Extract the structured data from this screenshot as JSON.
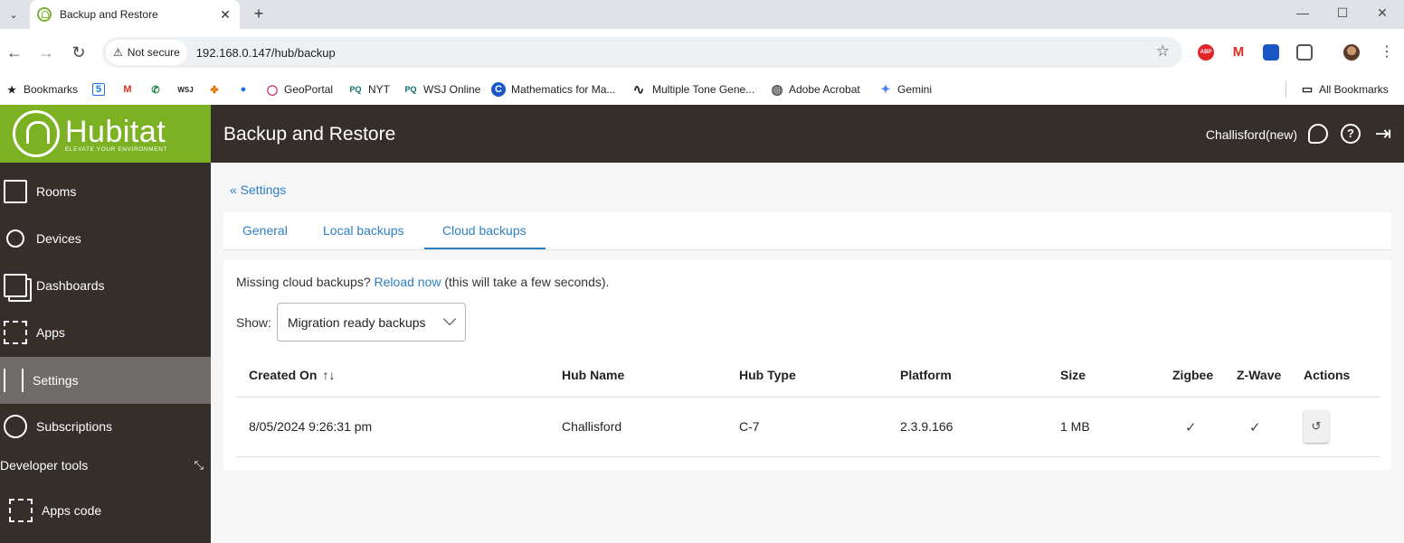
{
  "browser": {
    "tab_title": "Backup and Restore",
    "tab_close": "✕",
    "new_tab": "+",
    "tab_menu": "⌄",
    "window_controls": {
      "minimize": "—",
      "maximize": "☐",
      "close": "✕"
    },
    "nav": {
      "back": "←",
      "forward": "→",
      "reload": "↻"
    },
    "security_label": "Not secure",
    "url": "192.168.0.147/hub/backup",
    "star": "☆",
    "extensions": {
      "abp": "ABP",
      "gmail": "M",
      "more": "⋮"
    },
    "bookmarks": [
      {
        "label": "Bookmarks",
        "icon": "star-icon",
        "glyph": "★"
      },
      {
        "label": "",
        "icon": "calendar-icon",
        "glyph": "5"
      },
      {
        "label": "",
        "icon": "gmail-icon",
        "glyph": "M"
      },
      {
        "label": "",
        "icon": "phone-icon",
        "glyph": "✆"
      },
      {
        "label": "",
        "icon": "wsj-icon",
        "glyph": "WSJ"
      },
      {
        "label": "",
        "icon": "photos-icon",
        "glyph": "✤"
      },
      {
        "label": "",
        "icon": "contacts-icon",
        "glyph": "●"
      },
      {
        "label": "GeoPortal",
        "icon": "geoportal-icon",
        "glyph": "◯"
      },
      {
        "label": "NYT",
        "icon": "pq-icon",
        "glyph": "PQ"
      },
      {
        "label": "WSJ Online",
        "icon": "pq-icon",
        "glyph": "PQ"
      },
      {
        "label": "Mathematics for Ma...",
        "icon": "c-icon",
        "glyph": "C"
      },
      {
        "label": "Multiple Tone Gene...",
        "icon": "wave-icon",
        "glyph": "∿"
      },
      {
        "label": "Adobe Acrobat",
        "icon": "globe-icon",
        "glyph": "◍"
      },
      {
        "label": "Gemini",
        "icon": "gemini-icon",
        "glyph": "✦"
      }
    ],
    "all_bookmarks": "All Bookmarks",
    "all_bookmarks_glyph": "▭"
  },
  "app": {
    "brand_name": "Hubitat",
    "brand_tagline": "ELEVATE YOUR ENVIRONMENT",
    "page_title": "Backup and Restore",
    "hub_name": "Challisford(new)",
    "help_glyph": "?",
    "logout_glyph": "⇥",
    "colors": {
      "brand_green": "#7bb122",
      "header_bg": "#352e2a",
      "link_blue": "#2d7fc1",
      "active_nav": "#6e6b69"
    },
    "sidebar": {
      "items": [
        {
          "label": "Rooms",
          "icon": "rooms-icon"
        },
        {
          "label": "Devices",
          "icon": "lightbulb-icon"
        },
        {
          "label": "Dashboards",
          "icon": "dashboards-icon"
        },
        {
          "label": "Apps",
          "icon": "apps-icon"
        },
        {
          "label": "Settings",
          "icon": "sliders-icon",
          "active": true
        },
        {
          "label": "Subscriptions",
          "icon": "check-circle-icon"
        }
      ],
      "section_label": "Developer tools",
      "collapse_glyph": "⤡",
      "sub_items": [
        {
          "label": "Apps code",
          "icon": "apps-code-icon"
        }
      ]
    },
    "back_link": "« Settings",
    "tabs": [
      {
        "label": "General",
        "active": false
      },
      {
        "label": "Local backups",
        "active": false
      },
      {
        "label": "Cloud backups",
        "active": true
      }
    ],
    "notice": {
      "prefix": "Missing cloud backups?",
      "link": "Reload now",
      "suffix": "(this will take a few seconds)."
    },
    "show": {
      "label": "Show:",
      "selected": "Migration ready backups"
    },
    "table": {
      "headers": [
        "Created On",
        "Hub Name",
        "Hub Type",
        "Platform",
        "Size",
        "Zigbee",
        "Z-Wave",
        "Actions"
      ],
      "sort_glyph": "↑↓",
      "check_glyph": "✓",
      "restore_glyph": "↺",
      "rows": [
        {
          "created_on": "8/05/2024 9:26:31 pm",
          "hub_name": "Challisford",
          "hub_type": "C-7",
          "platform": "2.3.9.166",
          "size": "1 MB",
          "zigbee": true,
          "zwave": true
        }
      ]
    }
  }
}
